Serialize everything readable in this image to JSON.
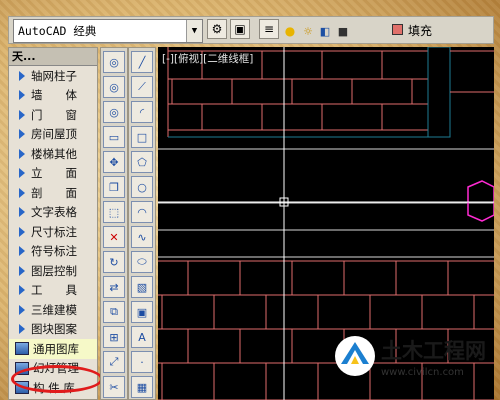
{
  "toolbar": {
    "workspace": "AutoCAD 经典",
    "fill_label": "填充"
  },
  "panel": {
    "title": "天..."
  },
  "menu": [
    {
      "label": "轴网柱子",
      "kind": "tri"
    },
    {
      "label": "墙　　体",
      "kind": "tri"
    },
    {
      "label": "门　　窗",
      "kind": "tri"
    },
    {
      "label": "房间屋顶",
      "kind": "tri"
    },
    {
      "label": "楼梯其他",
      "kind": "tri"
    },
    {
      "label": "立　　面",
      "kind": "tri"
    },
    {
      "label": "剖　　面",
      "kind": "tri"
    },
    {
      "label": "文字表格",
      "kind": "tri"
    },
    {
      "label": "尺寸标注",
      "kind": "tri"
    },
    {
      "label": "符号标注",
      "kind": "tri"
    },
    {
      "label": "图层控制",
      "kind": "tri"
    },
    {
      "label": "工　　具",
      "kind": "tri"
    },
    {
      "label": "三维建模",
      "kind": "tri"
    },
    {
      "label": "图块图案",
      "kind": "tri"
    },
    {
      "label": "通用图库",
      "kind": "tag",
      "selected": true
    },
    {
      "label": "幻灯管理",
      "kind": "tag"
    },
    {
      "label": "构 件 库",
      "kind": "tag"
    }
  ],
  "drawing": {
    "viewport_label": "[-][俯视][二维线框]"
  },
  "watermark": {
    "title": "土木工程网",
    "url": "www.civilcn.com"
  },
  "colors": {
    "brick": "#e06d6d",
    "fill_swatch": "#e0706a",
    "highlight": "#e01b1b",
    "panel_blue": "#2866c8",
    "cursor": "#ffffff",
    "teal_line": "#1e7d93",
    "magenta": "#ff2bd3"
  }
}
